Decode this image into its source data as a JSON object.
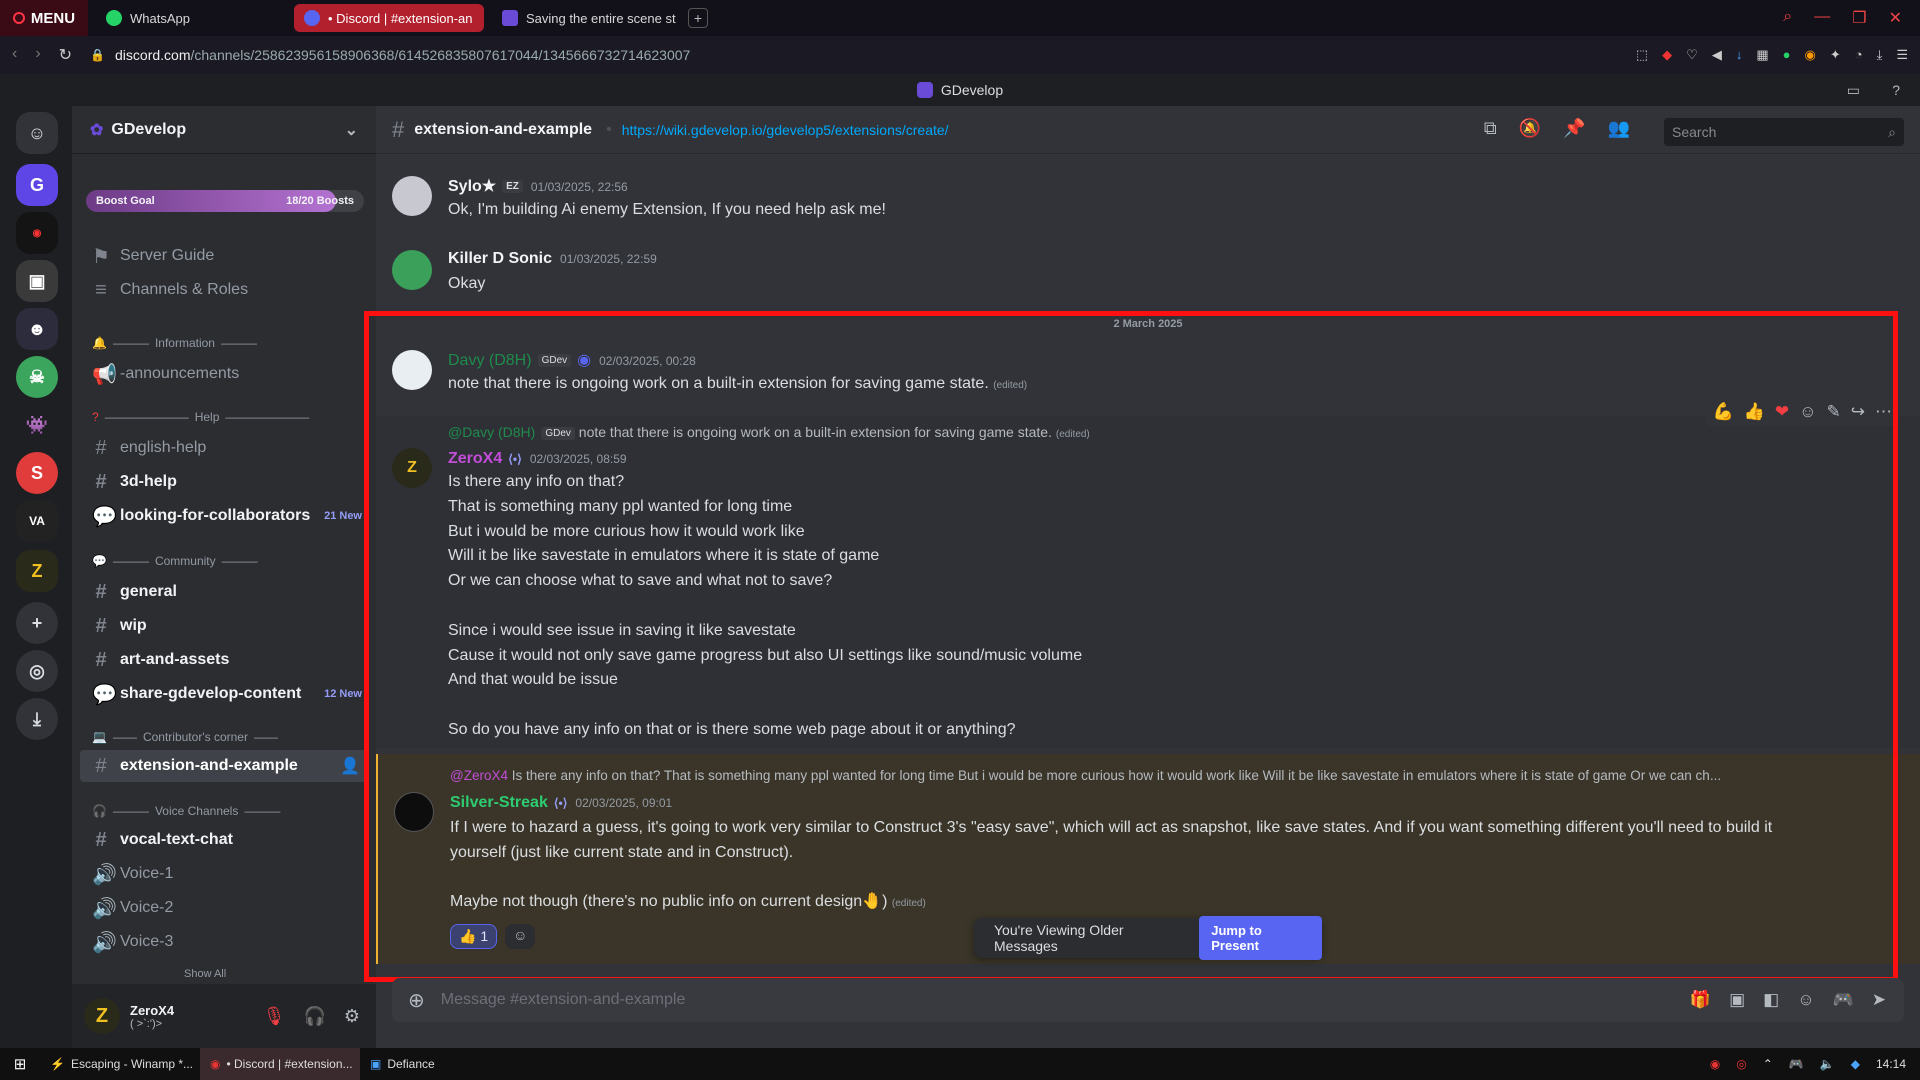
{
  "browser": {
    "menu_label": "MENU",
    "tabs": [
      {
        "label": "WhatsApp"
      },
      {
        "label": "• Discord | #extension-an"
      },
      {
        "label": "Saving the entire scene st"
      }
    ],
    "url_domain": "discord.com",
    "url_path": "/channels/258623956158906368/614526835807617044/1345666732714623007"
  },
  "discord": {
    "window_title": "GDevelop",
    "guild_name": "GDevelop",
    "boost": {
      "label": "Boost Goal",
      "progress": "18/20 Boosts",
      "fraction": 0.9
    },
    "sidebar": {
      "server_guide": "Server Guide",
      "channels_roles": "Channels & Roles",
      "categories": {
        "information": "Information",
        "help": "Help",
        "community": "Community",
        "contributors": "Contributor's corner",
        "voice": "Voice Channels"
      },
      "channels": [
        {
          "name": "-announcements"
        },
        {
          "name": "english-help"
        },
        {
          "name": "3d-help"
        },
        {
          "name": "looking-for-collaborators",
          "badge": "21 New"
        },
        {
          "name": "general"
        },
        {
          "name": "wip"
        },
        {
          "name": "art-and-assets"
        },
        {
          "name": "share-gdevelop-content",
          "badge": "12 New"
        },
        {
          "name": "extension-and-example"
        },
        {
          "name": "vocal-text-chat"
        },
        {
          "name": "Voice-1"
        },
        {
          "name": "Voice-2"
        },
        {
          "name": "Voice-3"
        }
      ],
      "show_all": "Show All"
    },
    "user": {
      "name": "ZeroX4",
      "status": "( >`:')>"
    },
    "header": {
      "channel": "extension-and-example",
      "topic": "https://wiki.gdevelop.io/gdevelop5/extensions/create/",
      "search_placeholder": "Search"
    },
    "messages": [
      {
        "author": "Sylo★",
        "tag": "EZ",
        "time": "01/03/2025, 22:56",
        "text": "Ok, I'm building Ai enemy Extension, If you need help ask me!"
      },
      {
        "author": "Killer D  Sonic",
        "time": "01/03/2025, 22:59",
        "text": "Okay"
      },
      {
        "date_divider": "2 March 2025"
      },
      {
        "author": "Davy (D8H)",
        "tag": "GDev",
        "time": "02/03/2025, 00:28",
        "text": "note that there is ongoing work on a built-in extension for saving game state.",
        "edited": "(edited)"
      },
      {
        "reply_author": "@Davy (D8H)",
        "reply_tag": "GDev",
        "reply_text": "note that there is ongoing work on a built-in extension for saving game state.",
        "reply_edited": "(edited)",
        "author": "ZeroX4",
        "time": "02/03/2025, 08:59",
        "text": "Is there any info on that?\nThat is something many ppl wanted for long time\nBut i would be more curious how it would work like\nWill it be like savestate in emulators where it is state of game\nOr we can choose what to save and what not to save?\n\nSince i would see issue in saving it like savestate\nCause it would not only save game progress but also UI settings like sound/music volume\nAnd that would be issue\n\nSo do you have any info on that or is there some web page about it or anything?"
      },
      {
        "reply_author": "@ZeroX4",
        "reply_text": "Is there any info on that? That is something many ppl wanted for long time But i would be more curious how it would work like Will it be like savestate in emulators where it is state of game Or we can ch...",
        "author": "Silver-Streak",
        "time": "02/03/2025, 09:01",
        "text": "If I were to hazard a guess, it's going to work very similar to Construct 3's \"easy save\", which will act as snapshot, like save states. And if you want something different you'll need to build it\nyourself (just like current state and in Construct).\n\nMaybe not though (there's no public info on current design",
        "text_end": ")",
        "edited": "(edited)",
        "reaction_count": "1"
      }
    ],
    "viewing_older": "You're Viewing Older Messages",
    "jump_to_present": "Jump to Present",
    "composer_placeholder": "Message #extension-and-example"
  },
  "taskbar": {
    "items": [
      {
        "label": "Escaping - Winamp *..."
      },
      {
        "label": "• Discord | #extension..."
      },
      {
        "label": "Defiance"
      }
    ],
    "clock": "14:14"
  },
  "colors": {
    "accent": "#5865f2",
    "highlight_box": "#ff1010",
    "opera_red": "#b3202d"
  }
}
